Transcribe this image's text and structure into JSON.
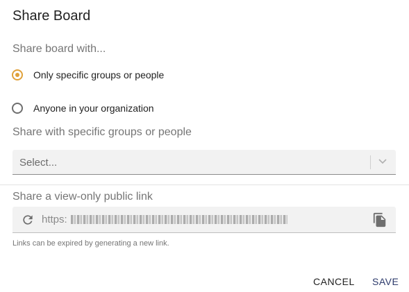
{
  "dialog": {
    "title": "Share Board"
  },
  "share_with": {
    "label": "Share board with...",
    "options": [
      {
        "label": "Only specific groups or people",
        "checked": true
      },
      {
        "label": "Anyone in your organization",
        "checked": false
      }
    ]
  },
  "specific": {
    "label": "Share with specific groups or people",
    "select_placeholder": "Select..."
  },
  "public_link": {
    "label": "Share a view-only public link",
    "url_prefix": "https:",
    "hint": "Links can be expired by generating a new link."
  },
  "actions": {
    "cancel_label": "CANCEL",
    "save_label": "SAVE"
  },
  "colors": {
    "accent": "#e0a13a",
    "primary": "#2c3a6b"
  },
  "icons": {
    "refresh": "refresh-icon",
    "copy": "copy-icon",
    "chevron": "chevron-down-icon"
  }
}
